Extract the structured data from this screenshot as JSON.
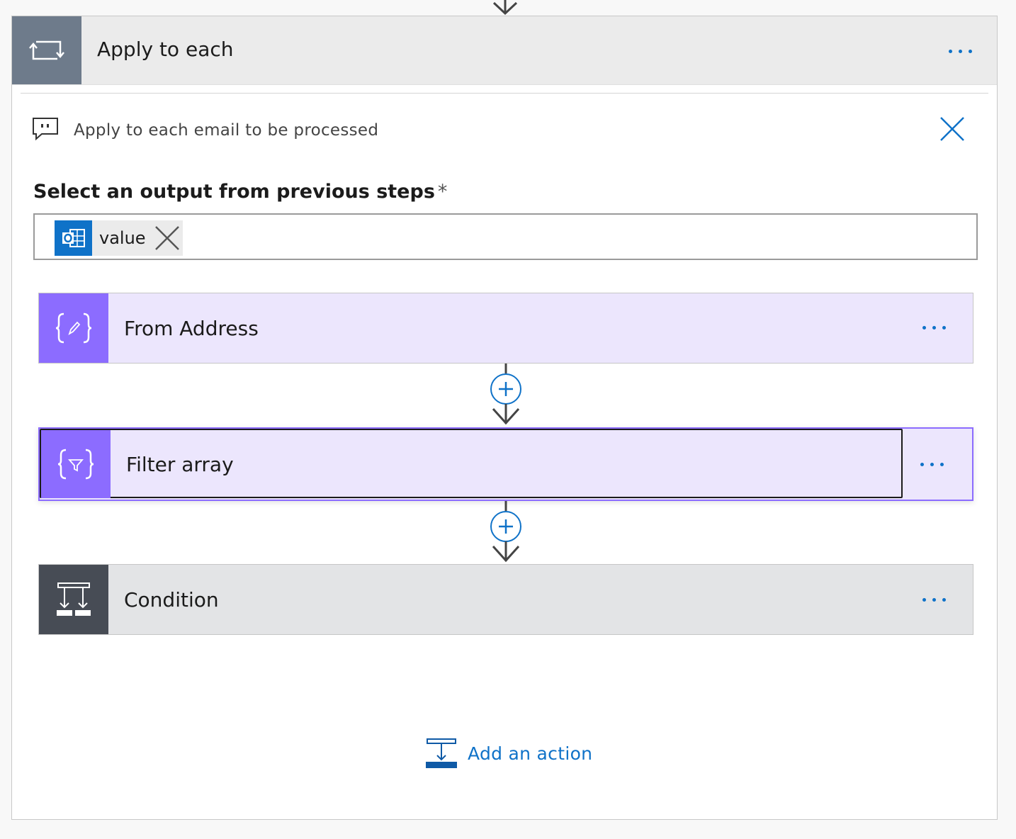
{
  "loop": {
    "title": "Apply to each",
    "comment": "Apply to each email to be processed",
    "field_label": "Select an output from previous steps",
    "required_mark": "*",
    "token_label": "value"
  },
  "actions": [
    {
      "title": "From Address",
      "color": "#8c6cff",
      "icon": "compose-icon"
    },
    {
      "title": "Filter array",
      "color": "#8c6cff",
      "icon": "filter-icon"
    },
    {
      "title": "Condition",
      "color": "#474c55",
      "icon": "condition-icon"
    }
  ],
  "add_action_label": "Add an action",
  "colors": {
    "accent": "#0f72c8",
    "loop_icon_bg": "#6e7b8b",
    "data_op_bg": "#ece6fd"
  }
}
